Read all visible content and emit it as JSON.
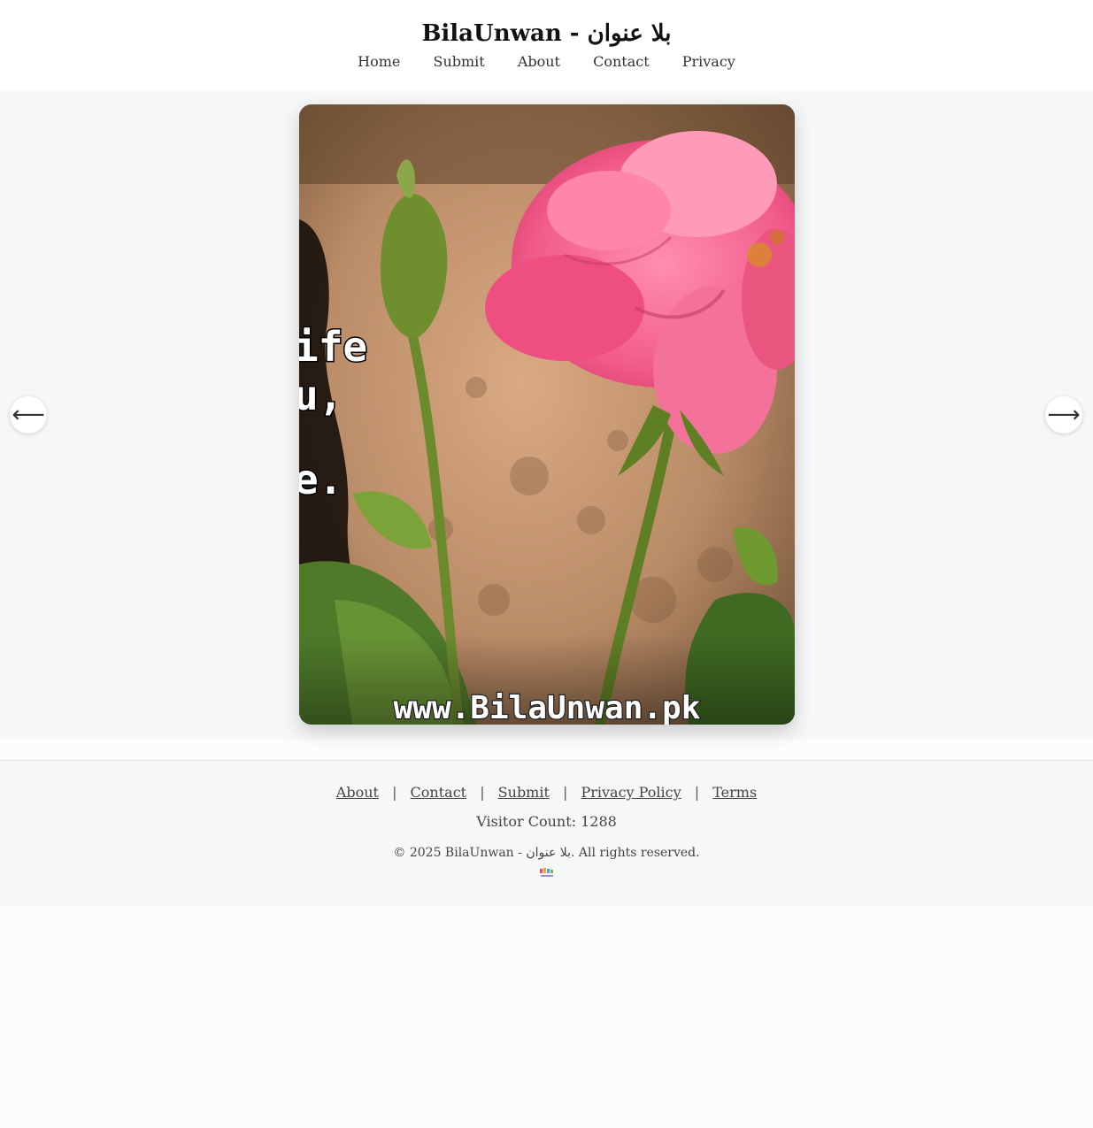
{
  "site": {
    "title": "BilaUnwan - بلا عنوان"
  },
  "nav": {
    "items": [
      {
        "label": "Home"
      },
      {
        "label": "Submit"
      },
      {
        "label": "About"
      },
      {
        "label": "Contact"
      },
      {
        "label": "Privacy"
      }
    ]
  },
  "slider": {
    "prev_icon": "arrow-left-icon",
    "next_icon": "arrow-right-icon",
    "prev_glyph": "⟵",
    "next_glyph": "⟶",
    "image": {
      "overlay_lines": [
        "ife",
        "u,",
        "e."
      ],
      "watermark": "www.BilaUnwan.pk"
    }
  },
  "footer": {
    "links": [
      {
        "label": "About"
      },
      {
        "label": "Contact"
      },
      {
        "label": "Submit"
      },
      {
        "label": "Privacy Policy"
      },
      {
        "label": "Terms"
      }
    ],
    "separator": "|",
    "visitor_count": "Visitor Count: 1288",
    "copyright": "© 2025 BilaUnwan - بلا عنوان. All rights reserved."
  },
  "colors": {
    "page_bg": "#fcfcfc",
    "stage_bg": "#f6f7f9",
    "rose": "#f0608a",
    "stem": "#6a8a2c"
  }
}
